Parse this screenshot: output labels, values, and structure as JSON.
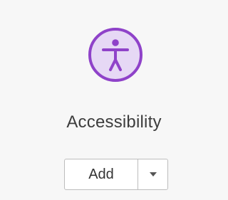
{
  "tool": {
    "icon": "accessibility-icon",
    "title": "Accessibility",
    "add_label": "Add",
    "dropdown_icon": "chevron-down-icon"
  },
  "colors": {
    "accent": "#8f42c9",
    "icon_fill": "#e6d8f5",
    "background": "#f7f7f7",
    "text": "#3d3d3d",
    "button_border": "#bdbdbd"
  }
}
